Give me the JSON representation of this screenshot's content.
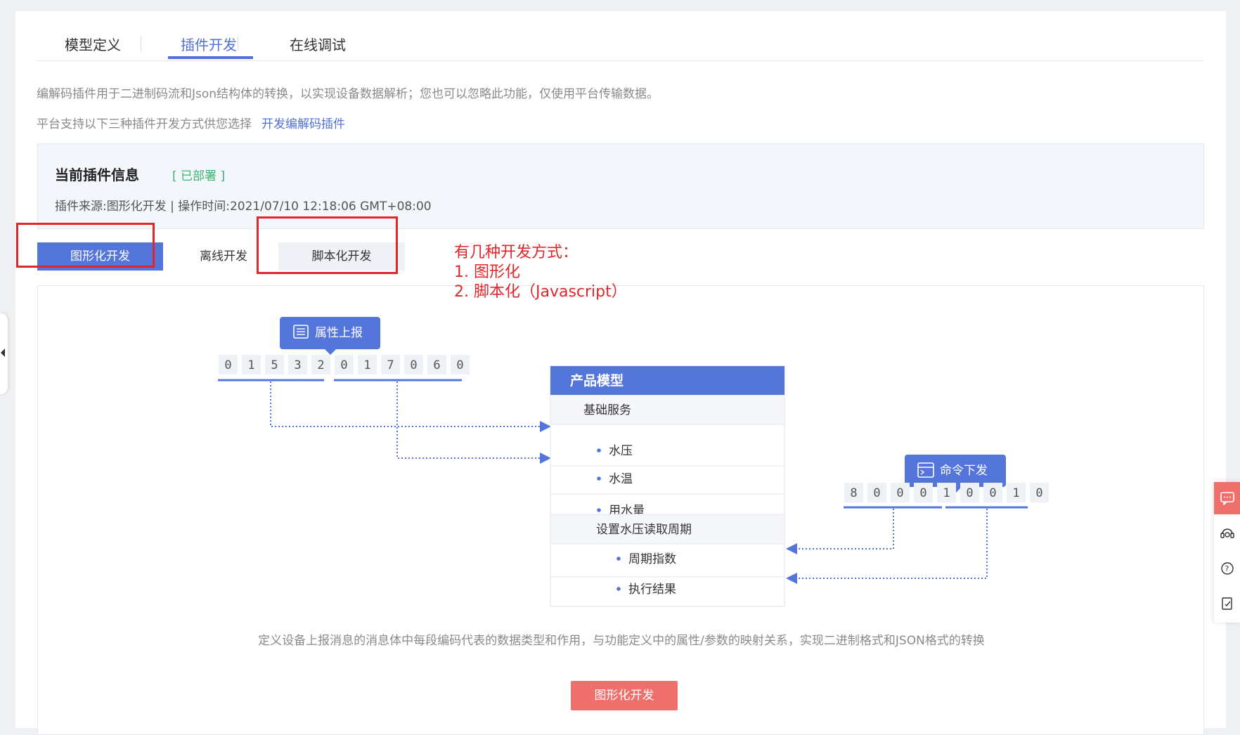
{
  "tabs": [
    {
      "label": "模型定义"
    },
    {
      "label": "插件开发"
    },
    {
      "label": "在线调试"
    }
  ],
  "active_tab": "插件开发",
  "description": "编解码插件用于二进制码流和Json结构体的转换，以实现设备数据解析；您也可以忽略此功能，仅使用平台传输数据。",
  "support_text": "平台支持以下三种插件开发方式供您选择",
  "support_link": "开发编解码插件",
  "plugin_info": {
    "title": "当前插件信息",
    "status": "[ 已部署 ]",
    "meta": "插件来源:图形化开发  |  操作时间:2021/07/10 12:18:06 GMT+08:00"
  },
  "dev_buttons": [
    {
      "label": "图形化开发"
    },
    {
      "label": "离线开发"
    },
    {
      "label": "脚本化开发"
    }
  ],
  "annotation": {
    "line1": "有几种开发方式：",
    "line2": "1. 图形化",
    "line3": "2. 脚本化（Javascript）"
  },
  "diagram": {
    "report_badge": "属性上报",
    "report_bytes": [
      "0",
      "1",
      "5",
      "3",
      "2",
      "0",
      "1",
      "7",
      "0",
      "6",
      "0"
    ],
    "model_title": "产品模型",
    "service": "基础服务",
    "properties": [
      "水压",
      "水温",
      "用水量"
    ],
    "command": "设置水压读取周期",
    "command_items": [
      "周期指数",
      "执行结果"
    ],
    "command_badge": "命令下发",
    "command_bytes": [
      "8",
      "0",
      "0",
      "0",
      "1",
      "0",
      "0",
      "1",
      "0"
    ]
  },
  "bottom_description": "定义设备上报消息的消息体中每段编码代表的数据类型和作用，与功能定义中的属性/参数的映射关系，实现二进制格式和JSON格式的转换",
  "bottom_button": "图形化开发",
  "colors": {
    "primary": "#5476db",
    "accent_red": "#e0262b",
    "button_red": "#ef6f6c",
    "status_green": "#3cb371"
  },
  "right_toolbar": [
    "chat-icon",
    "customer-service-icon",
    "help-icon",
    "feedback-icon"
  ]
}
